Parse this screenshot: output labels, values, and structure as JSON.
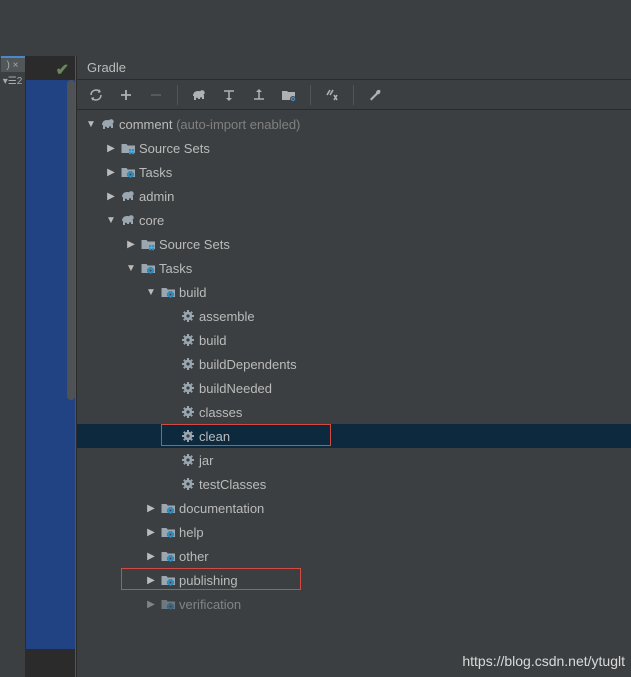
{
  "panel": {
    "title": "Gradle"
  },
  "leftTab": {
    "close": ")",
    "label": "▾☰2"
  },
  "tree": {
    "root": {
      "label": "comment",
      "annotation": "(auto-import enabled)"
    },
    "root_children": {
      "sourceSets": "Source Sets",
      "tasks": "Tasks",
      "admin": "admin",
      "core": "core"
    },
    "core": {
      "sourceSets": "Source Sets",
      "tasks": "Tasks"
    },
    "coreTasks": {
      "build": "build",
      "documentation": "documentation",
      "help": "help",
      "other": "other",
      "publishing": "publishing",
      "verification": "verification"
    },
    "buildTasks": {
      "assemble": "assemble",
      "build": "build",
      "buildDependents": "buildDependents",
      "buildNeeded": "buildNeeded",
      "classes": "classes",
      "clean": "clean",
      "jar": "jar",
      "testClasses": "testClasses"
    }
  },
  "watermark": "https://blog.csdn.net/ytuglt"
}
